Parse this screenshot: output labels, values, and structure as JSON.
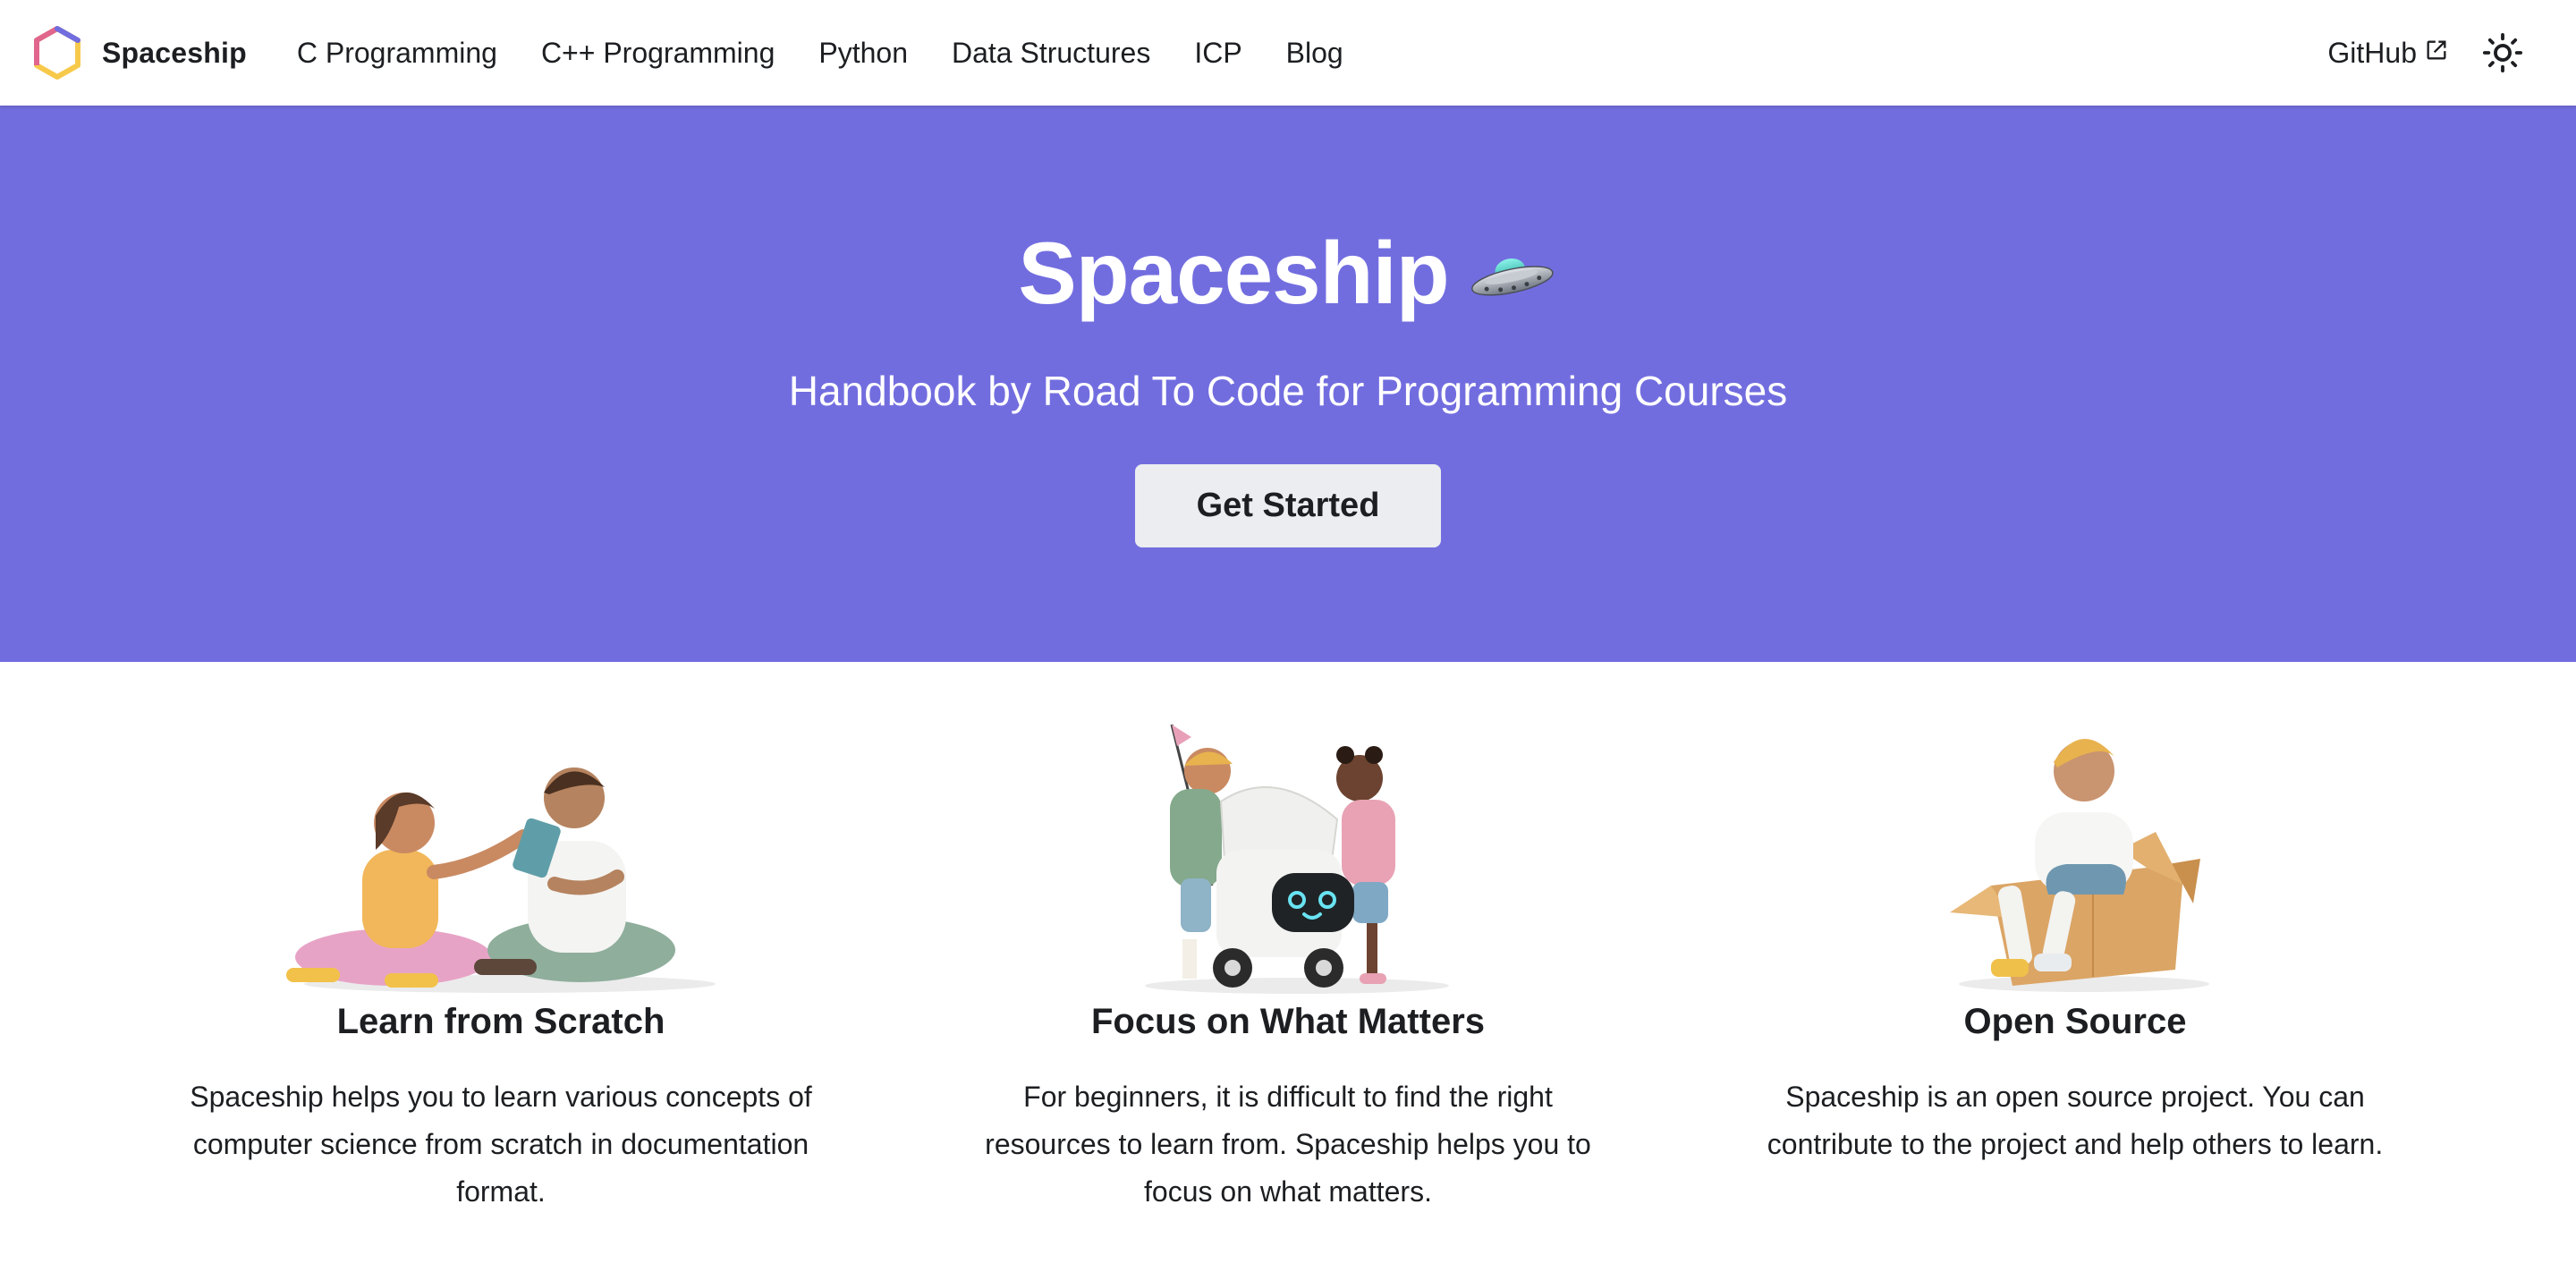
{
  "navbar": {
    "brand_title": "Spaceship",
    "links": [
      {
        "label": "C Programming"
      },
      {
        "label": "C++ Programming"
      },
      {
        "label": "Python"
      },
      {
        "label": "Data Structures"
      },
      {
        "label": "ICP"
      },
      {
        "label": "Blog"
      }
    ],
    "github_label": "GitHub",
    "theme_toggle_icon": "sun-icon",
    "external_link_icon": "external-link-icon"
  },
  "hero": {
    "title": "Spaceship",
    "title_icon": "ufo-icon",
    "subtitle": "Handbook by Road To Code for Programming Courses",
    "button_label": "Get Started",
    "background_color": "#726ddf"
  },
  "features": [
    {
      "title": "Learn from Scratch",
      "description": "Spaceship helps you to learn various concepts of computer science from scratch in documentation format.",
      "illustration": "two-people-studying-tablet-illustration"
    },
    {
      "title": "Focus on What Matters",
      "description": "For beginners, it is difficult to find the right resources to learn from. Spaceship helps you to focus on what matters.",
      "illustration": "two-kids-with-delivery-robot-illustration"
    },
    {
      "title": "Open Source",
      "description": "Spaceship is an open source project. You can contribute to the project and help others to learn.",
      "illustration": "boy-sitting-in-box-illustration"
    }
  ]
}
